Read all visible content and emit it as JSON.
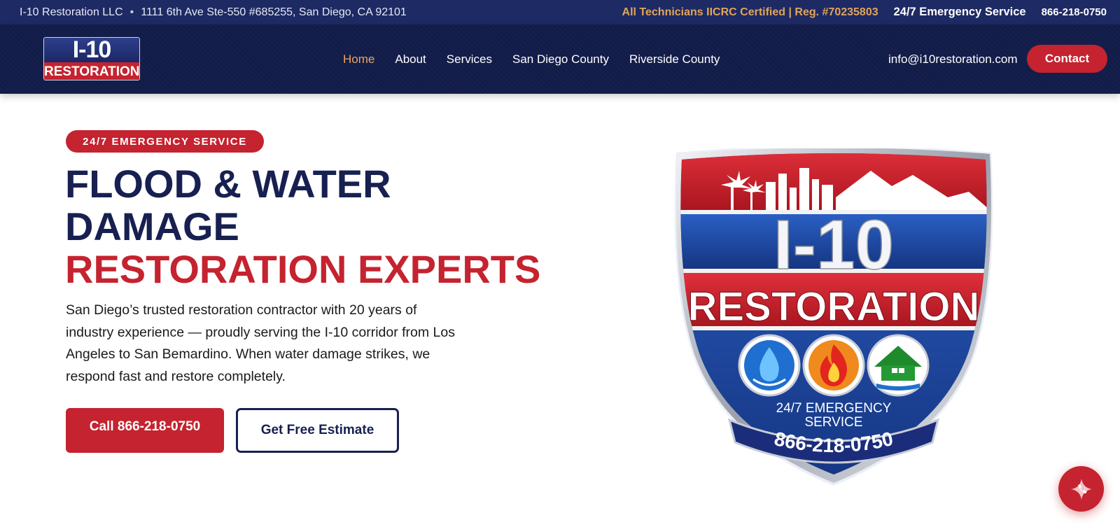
{
  "topbar": {
    "company": "I-10 Restoration LLC",
    "separator": "•",
    "address": "1111 6th Ave Ste-550 #685255, San Diego, CA 92101",
    "certification": "All Technicians IICRC Certified | Reg. #70235803",
    "emergency": "24/7 Emergency Service",
    "phone": "866-218-0750"
  },
  "nav": {
    "logo": {
      "top": "I-10",
      "bottom": "RESTORATION"
    },
    "items": [
      {
        "label": "Home",
        "active": true
      },
      {
        "label": "About"
      },
      {
        "label": "Services"
      },
      {
        "label": "San Diego County"
      },
      {
        "label": "Riverside County"
      }
    ],
    "email": "info@i10restoration.com",
    "contact_label": "Contact"
  },
  "hero": {
    "badge": "24/7 EMERGENCY SERVICE",
    "title_line1": "FLOOD & WATER",
    "title_line2": "DAMAGE",
    "title_line3": "RESTORATION EXPERTS",
    "description": "San Diego’s trusted restoration contractor with 20 years of industry experience — proudly serving the I-10 corridor from Los Angeles to San Bemardino. When water damage strikes, we respond fast and restore completely.",
    "call_button": "Call 866-218-0750",
    "estimate_button": "Get Free Estimate"
  },
  "shield": {
    "title": "I-10",
    "subtitle": "RESTORATION",
    "service_line1": "24/7 EMERGENCY",
    "service_line2": "SERVICE",
    "phone": "866-218-0750",
    "icons": [
      "water-drop-icon",
      "fire-icon",
      "house-icon"
    ]
  },
  "colors": {
    "brand_red": "#c4232f",
    "navy": "#172050",
    "topbar": "#1e2a63",
    "nav": "#121c48",
    "accent_gold": "#e1a45a"
  }
}
